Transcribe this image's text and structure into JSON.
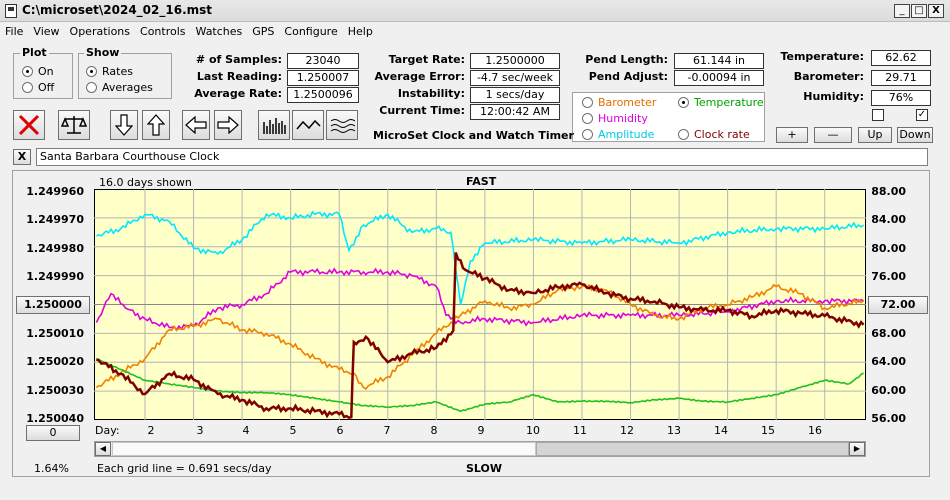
{
  "window": {
    "title": "C:\\microset\\2024_02_16.mst",
    "min": "_",
    "max": "□",
    "close": "X"
  },
  "menu": [
    "File",
    "View",
    "Operations",
    "Controls",
    "Watches",
    "GPS",
    "Configure",
    "Help"
  ],
  "plot_group": {
    "title": "Plot",
    "options": [
      "On",
      "Off"
    ],
    "selected": "On"
  },
  "show_group": {
    "title": "Show",
    "options": [
      "Rates",
      "Averages"
    ],
    "selected": "Rates"
  },
  "stats": {
    "samples_label": "# of Samples:",
    "samples": "23040",
    "last_reading_label": "Last Reading:",
    "last_reading": "1.250007",
    "average_rate_label": "Average Rate:",
    "average_rate": "1.2500096",
    "target_rate_label": "Target Rate:",
    "target_rate": "1.2500000",
    "average_error_label": "Average Error:",
    "average_error": "-4.7 sec/week",
    "instability_label": "Instability:",
    "instability": "1 secs/day",
    "current_time_label": "Current Time:",
    "current_time": "12:00:42 AM",
    "pend_length_label": "Pend Length:",
    "pend_length": "61.144 in",
    "pend_adjust_label": "Pend Adjust:",
    "pend_adjust": "-0.00094 in",
    "temperature_label": "Temperature:",
    "temperature": "62.62",
    "barometer_label": "Barometer:",
    "barometer": "29.71",
    "humidity_label": "Humidity:",
    "humidity": "76%"
  },
  "app_name": "MicroSet Clock and Watch Timer",
  "aux_options": [
    {
      "label": "Barometer",
      "color": "#e07000",
      "selected": false
    },
    {
      "label": "Temperature",
      "color": "#00a000",
      "selected": true
    },
    {
      "label": "Humidity",
      "color": "#e000e0",
      "selected": false
    },
    {
      "label": "Amplitude",
      "color": "#00c8e0",
      "selected": false
    },
    {
      "label": "Clock rate",
      "color": "#800000",
      "selected": false
    }
  ],
  "scale_buttons": [
    "+",
    "—",
    "Up",
    "Down"
  ],
  "checkboxes": [
    {
      "checked": false
    },
    {
      "checked": true
    }
  ],
  "description": {
    "close": "X",
    "value": "Santa Barbara Courthouse Clock"
  },
  "chart_data": {
    "type": "line",
    "top_label": "FAST",
    "bottom_label": "SLOW",
    "days_shown": "16.0 days shown",
    "grid_note": "Each grid line = 0.691 secs/day",
    "percent": "1.64%",
    "center_button": "1.250000",
    "right_center_button": "72.00",
    "zero_button": "0",
    "day_label": "Day:",
    "x_ticks": [
      "2",
      "3",
      "4",
      "5",
      "6",
      "7",
      "8",
      "9",
      "10",
      "11",
      "12",
      "13",
      "14",
      "15",
      "16"
    ],
    "y_left_ticks": [
      "1.249960",
      "1.249970",
      "1.249980",
      "1.249990",
      "1.250000",
      "1.250010",
      "1.250020",
      "1.250030",
      "1.250040"
    ],
    "y_right_ticks": [
      "88.00",
      "84.00",
      "80.00",
      "76.00",
      "72.00",
      "68.00",
      "64.00",
      "60.00",
      "56.00"
    ],
    "xlim": [
      0.95,
      16.85
    ],
    "ylim_left": [
      1.24996,
      1.25004
    ],
    "ylim_right": [
      56,
      88
    ],
    "series": [
      {
        "name": "Amplitude",
        "color": "#00e8ff",
        "axis": "right",
        "x": [
          1,
          1.5,
          2,
          2.5,
          3,
          3.5,
          4,
          4.5,
          5,
          5.5,
          6,
          6.2,
          6.5,
          7,
          7.5,
          8,
          8.3,
          8.5,
          8.7,
          9,
          10,
          11,
          12,
          13,
          14,
          15,
          16,
          16.8
        ],
        "y": [
          81.5,
          82.5,
          84.5,
          83.5,
          79.8,
          79.0,
          81.0,
          84.5,
          84.0,
          84.5,
          84.5,
          79.5,
          83.0,
          84.5,
          82.0,
          82.5,
          82.0,
          72.0,
          78.0,
          80.5,
          81.0,
          80.5,
          81.0,
          80.5,
          82.0,
          82.5,
          82.5,
          83.0
        ]
      },
      {
        "name": "Humidity",
        "color": "#e000e0",
        "axis": "right",
        "x": [
          1,
          1.3,
          1.6,
          2,
          2.5,
          3,
          3.5,
          4,
          4.5,
          5,
          5.5,
          6,
          6.5,
          7,
          7.5,
          8,
          8.2,
          8.5,
          9,
          10,
          11,
          12,
          13,
          14,
          15,
          16,
          16.8
        ],
        "y": [
          69.5,
          73.5,
          71.5,
          70.0,
          68.8,
          69.0,
          71.5,
          72.0,
          73.5,
          76.5,
          76.5,
          76.5,
          76.5,
          76.5,
          76.0,
          74.5,
          70.5,
          69.5,
          70.0,
          69.5,
          70.5,
          70.5,
          70.5,
          71.0,
          72.5,
          72.5,
          72.5
        ]
      },
      {
        "name": "Barometer",
        "color": "#f08000",
        "axis": "right",
        "x": [
          1,
          1.5,
          2,
          2.5,
          3,
          3.5,
          4,
          4.5,
          5,
          5.5,
          6,
          6.3,
          6.5,
          7,
          7.5,
          8,
          8.5,
          9,
          9.5,
          10,
          10.5,
          11,
          11.5,
          12,
          12.5,
          13,
          13.5,
          14,
          14.5,
          15,
          15.5,
          16,
          16.8
        ],
        "y": [
          60.5,
          62.5,
          64.5,
          68.5,
          69.0,
          70.0,
          68.5,
          68.0,
          66.5,
          64.5,
          63.0,
          62.5,
          60.5,
          62.0,
          65.0,
          68.0,
          70.5,
          72.5,
          71.5,
          72.0,
          74.0,
          74.5,
          74.0,
          72.0,
          70.5,
          70.0,
          71.5,
          72.0,
          73.0,
          74.5,
          73.5,
          71.5,
          72.5
        ]
      },
      {
        "name": "Temperature",
        "color": "#20c020",
        "axis": "right",
        "x": [
          1,
          1.5,
          2,
          2.5,
          3,
          3.5,
          4,
          4.5,
          5,
          5.5,
          6,
          6.5,
          7,
          7.5,
          8,
          8.5,
          9,
          9.5,
          10,
          10.5,
          11,
          11.5,
          12,
          12.5,
          13,
          13.5,
          14,
          14.5,
          15,
          15.5,
          16,
          16.5,
          16.8
        ],
        "y": [
          64.5,
          63.0,
          61.5,
          61.0,
          60.5,
          60.0,
          59.8,
          59.8,
          59.5,
          59.0,
          58.5,
          58.0,
          57.8,
          58.0,
          58.5,
          57.2,
          58.2,
          58.5,
          59.5,
          58.5,
          58.6,
          58.6,
          58.4,
          58.8,
          59.0,
          58.6,
          58.5,
          59.0,
          59.5,
          60.5,
          61.5,
          61.0,
          62.5
        ]
      },
      {
        "name": "Clock rate",
        "color": "#800000",
        "axis": "left",
        "x": [
          1,
          1.5,
          2,
          2.5,
          3,
          3.5,
          4,
          4.5,
          5,
          5.5,
          6,
          6.25,
          6.3,
          6.6,
          7,
          7.5,
          8,
          8.35,
          8.4,
          8.6,
          9,
          9.5,
          10,
          10.5,
          11,
          11.5,
          12,
          12.5,
          13,
          13.5,
          14,
          14.5,
          15,
          15.5,
          16,
          16.8
        ],
        "y": [
          1.250019,
          1.250024,
          1.250031,
          1.250024,
          1.250026,
          1.250031,
          1.250033,
          1.250036,
          1.250036,
          1.250037,
          1.250038,
          1.250039,
          1.250013,
          1.250012,
          1.25002,
          1.250017,
          1.250015,
          1.250009,
          1.249982,
          1.249988,
          1.249991,
          1.249995,
          1.249996,
          1.249994,
          1.249993,
          1.249996,
          1.249998,
          1.249999,
          1.250001,
          1.250002,
          1.250002,
          1.250004,
          1.250002,
          1.250003,
          1.250004,
          1.250007
        ]
      }
    ]
  }
}
